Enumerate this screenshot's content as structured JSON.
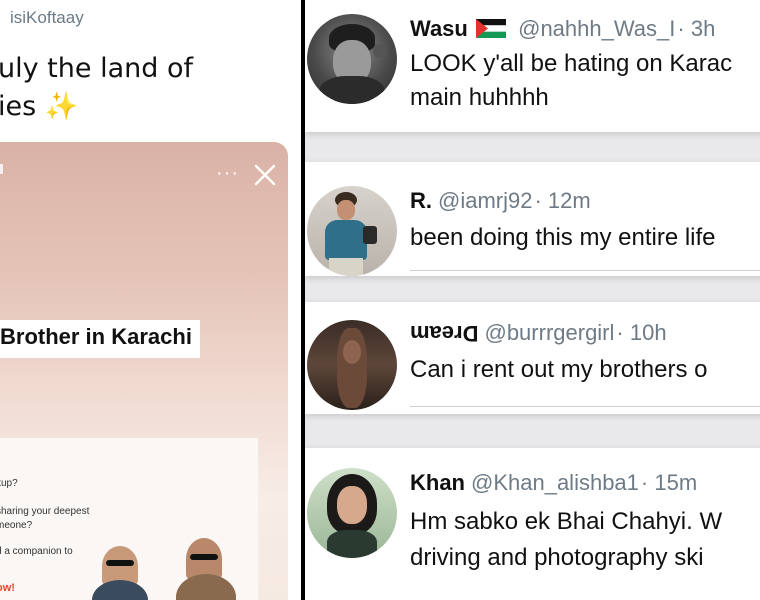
{
  "left_tweet": {
    "handle": "isiKoftaay",
    "text_line1": "uly the land of",
    "text_line2": "ies",
    "sparkles": "✨"
  },
  "story": {
    "more_label": "···",
    "headline": "Brother in Karachi",
    "ad_lines": [
      "kup?",
      "sharing your deepest",
      "meone?",
      "d a companion to"
    ],
    "ad_cta": "ow!"
  },
  "tweets": [
    {
      "name": "Wasu",
      "handle": "@nahhh_Was_I",
      "time": "· 3h",
      "lines": [
        "LOOK y'all be hating on Karac",
        "main huhhhh"
      ]
    },
    {
      "name": "R.",
      "handle": "@iamrj92",
      "time": "· 12m",
      "lines": [
        "been doing this my entire life"
      ]
    },
    {
      "name": "Dream",
      "handle": "@burrrgergirl",
      "time": "· 10h",
      "lines": [
        "Can i rent out my brothers o"
      ]
    },
    {
      "name": "Khan",
      "handle": "@Khan_alishba1",
      "time": "· 15m",
      "lines": [
        "Hm sabko ek Bhai Chahyi. W",
        "driving and photography ski"
      ]
    }
  ],
  "colors": {
    "panel_gap": "#000000",
    "handle_gray": "#6e7b86",
    "story_gradient_top": "#d9b2a5",
    "ad_cta": "#e04a2b"
  }
}
